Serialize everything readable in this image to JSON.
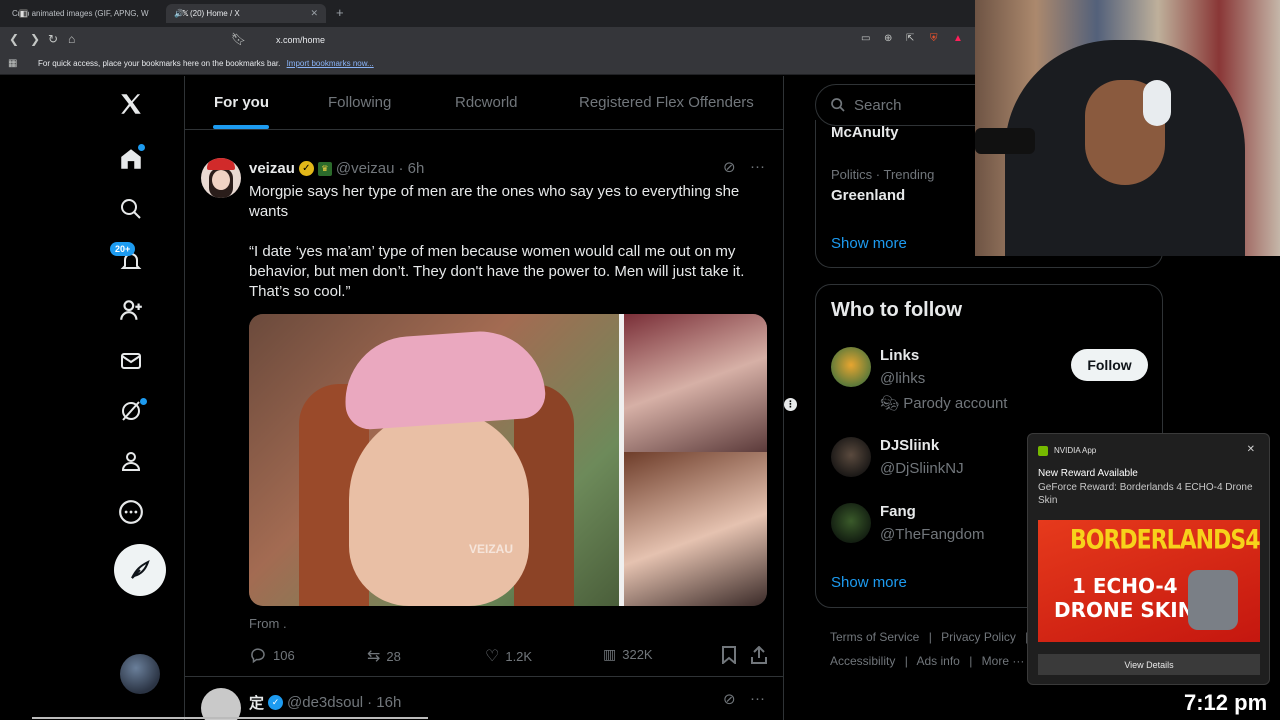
{
  "browser": {
    "tabs": [
      {
        "title": "Crop animated images (GIF, APNG, W",
        "active": false
      },
      {
        "title": "(20) Home / X",
        "active": true
      }
    ],
    "url": "x.com/home",
    "bookmarks_message": "For quick access, place your bookmarks here on the bookmarks bar.",
    "bookmarks_link": "Import bookmarks now..."
  },
  "nav": {
    "notifications_badge": "20+",
    "icons": [
      "x-logo-icon",
      "home-icon",
      "search-icon",
      "notifications-icon",
      "communities-icon",
      "messages-icon",
      "grok-icon",
      "profile-icon",
      "more-icon",
      "post-icon"
    ]
  },
  "timeline": {
    "tabs": [
      "For you",
      "Following",
      "Rdcworld",
      "Registered Flex Offenders"
    ],
    "selected_tab": "For you",
    "post": {
      "name": "veizau",
      "handle": "@veizau",
      "time": "· 6h",
      "text_line1": "Morgpie says her type of men are the ones who say yes to everything she wants",
      "text_line2": "“I date ‘yes ma’am’ type of men because women would call me out on my behavior, but men don’t. They don't have the power to. Men will just take it. That’s so cool.”",
      "media_watermark": "VEIZAU",
      "from_label": "From .",
      "replies": "106",
      "reposts": "28",
      "likes": "1.2K",
      "views": "322K"
    },
    "post2": {
      "name": "定",
      "handle": "@de3dsoul",
      "time": "· 16h"
    }
  },
  "sidebar": {
    "search_placeholder": "Search",
    "trends": {
      "partial_name": "McAnulty",
      "meta": "Politics · Trending",
      "name": "Greenland",
      "show_more": "Show more"
    },
    "who_to_follow": {
      "title": "Who to follow",
      "accounts": [
        {
          "name": "Links",
          "handle": "@lihks",
          "note": "Parody account"
        },
        {
          "name": "DJSliink",
          "handle": "@DjSliinkNJ"
        },
        {
          "name": "Fang",
          "handle": "@TheFangdom"
        }
      ],
      "follow_label": "Follow",
      "show_more": "Show more"
    },
    "footer": {
      "row1": [
        "Terms of Service",
        "Privacy Policy",
        "C"
      ],
      "row2": [
        "Accessibility",
        "Ads info",
        "More ···"
      ]
    }
  },
  "toast": {
    "app_name": "NVIDIA App",
    "title": "New Reward Available",
    "body": "GeForce Reward: Borderlands 4 ECHO-4 Drone Skin",
    "promo_title": "BORDERLANDS4",
    "promo_line1": "1 ECHO-4",
    "promo_line2": "DRONE SKIN",
    "button": "View Details"
  },
  "clock": "7:12 pm",
  "colors": {
    "accent": "#1d9bf0",
    "background": "#000000",
    "nvidia_green": "#76b900"
  }
}
